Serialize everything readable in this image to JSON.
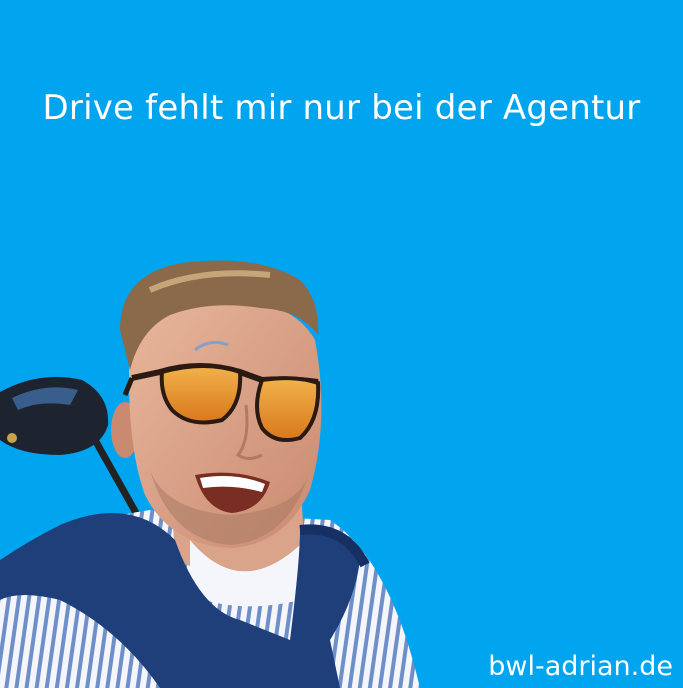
{
  "headline": "Drive fehlt mir nur bei der Agentur",
  "watermark": "bwl-adrian.de",
  "colors": {
    "background": "#00a4ef",
    "text": "#ffffff",
    "sweater": "#1f3f7a",
    "sunglass_lens": "#e89a2a"
  },
  "icons": {
    "golf_club": "golf-driver-icon",
    "person": "smiling-man-with-sunglasses"
  }
}
